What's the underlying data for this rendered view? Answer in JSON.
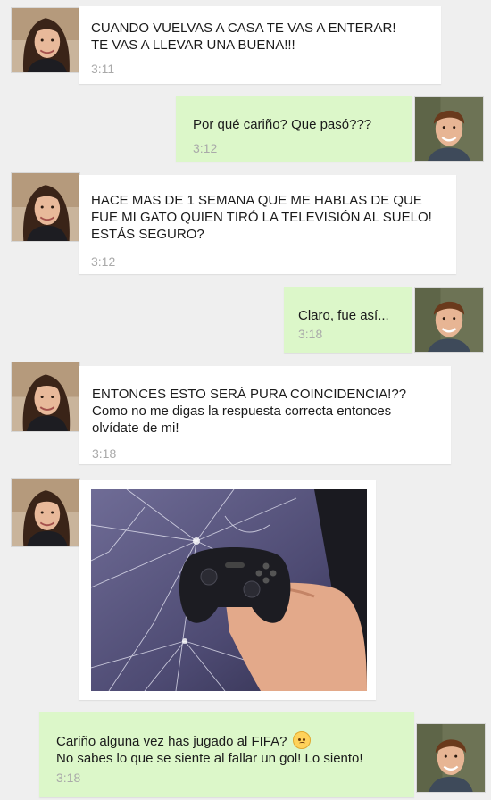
{
  "messages": [
    {
      "from": "girlfriend",
      "text": "CUANDO VUELVAS A CASA TE VAS A ENTERAR!\nTE VAS A LLEVAR UNA BUENA!!!",
      "time": "3:11"
    },
    {
      "from": "me",
      "text": "Por qué cariño? Que pasó???",
      "time": "3:12"
    },
    {
      "from": "girlfriend",
      "text": "HACE MAS DE 1 SEMANA QUE ME HABLAS DE QUE\nFUE MI GATO QUIEN TIRÓ LA TELEVISIÓN AL SUELO!\nESTÁS SEGURO?",
      "time": "3:12"
    },
    {
      "from": "me",
      "text": "Claro, fue así...",
      "time": "3:18"
    },
    {
      "from": "girlfriend",
      "text": "ENTONCES ESTO SERÁ PURA COINCIDENCIA!??\nComo no me digas la respuesta correcta entonces\nolvídate de mi!",
      "time": "3:18"
    },
    {
      "from": "girlfriend",
      "type": "image",
      "image": "cracked-tv-with-game-controller"
    },
    {
      "from": "me",
      "line1": "Cariño alguna vez has jugado al FIFA?",
      "line2": "No sabes lo que se siente al fallar un gol! Lo siento!",
      "emoji": "disappointed-face",
      "time": "3:18"
    }
  ],
  "colors": {
    "background": "#efefef",
    "incoming_bubble": "#ffffff",
    "outgoing_bubble": "#dcf7c9",
    "timestamp": "#a9a9a9"
  }
}
